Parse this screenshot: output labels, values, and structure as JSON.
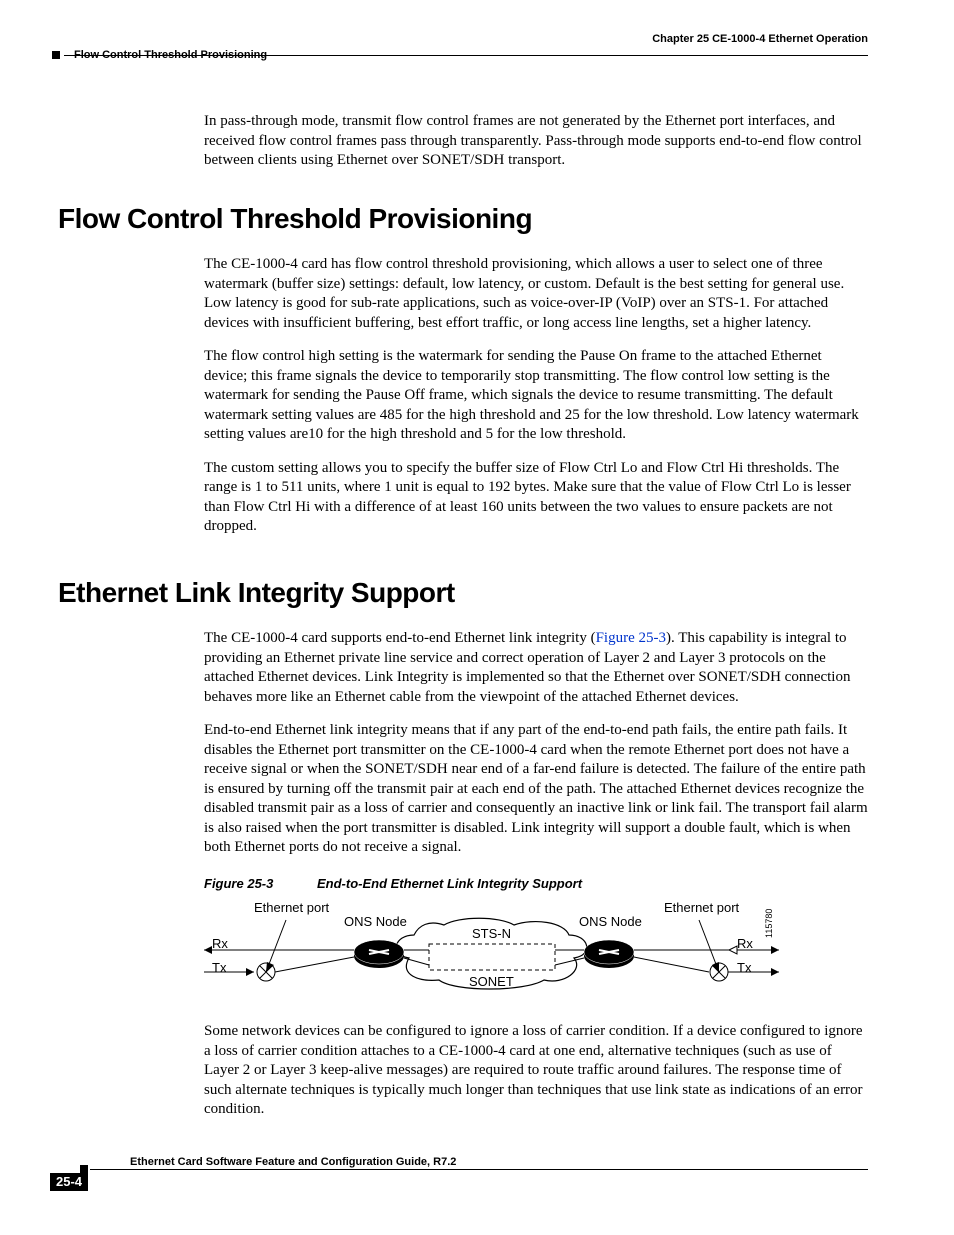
{
  "header": {
    "chapter": "Chapter 25 CE-1000-4 Ethernet Operation",
    "section": "Flow Control Threshold Provisioning"
  },
  "intro_para": "In pass-through mode, transmit flow control frames are not generated by the Ethernet port interfaces, and received flow control frames pass through transparently. Pass-through mode supports end-to-end flow control between clients using Ethernet over SONET/SDH transport.",
  "sec1": {
    "title": "Flow Control Threshold Provisioning",
    "p1": "The CE-1000-4 card has flow control threshold provisioning, which allows a user to select one of three watermark (buffer size) settings: default, low latency, or custom. Default is the best setting for general use. Low latency is good for sub-rate applications, such as voice-over-IP (VoIP) over an STS-1. For attached devices with insufficient buffering, best effort traffic, or long access line lengths, set a higher latency.",
    "p2": "The flow control high setting is the watermark for sending the Pause On frame to the attached Ethernet device; this frame signals the device to temporarily stop transmitting. The flow control low setting is the watermark for sending the Pause Off frame, which signals the device to resume transmitting. The default watermark setting values are 485 for the high threshold and 25 for the low threshold. Low latency watermark setting values are10 for the high threshold and 5 for the low threshold.",
    "p3": "The custom setting allows you to specify the buffer size of Flow Ctrl Lo and Flow Ctrl Hi thresholds. The range is 1 to 511 units, where 1 unit is equal to 192 bytes. Make sure that the value of Flow Ctrl Lo is lesser than Flow Ctrl Hi with a difference of at least 160 units between the two values to ensure packets are not dropped."
  },
  "sec2": {
    "title": "Ethernet Link Integrity Support",
    "p1a": "The CE-1000-4 card supports end-to-end Ethernet link integrity (",
    "p1link": "Figure 25-3",
    "p1b": "). This capability is integral to providing an Ethernet private line service and correct operation of Layer 2 and Layer 3 protocols on the attached Ethernet devices. Link Integrity is implemented so that the Ethernet over SONET/SDH connection behaves more like an Ethernet cable from the viewpoint of the attached Ethernet devices.",
    "p2": "End-to-end Ethernet link integrity means that if any part of the end-to-end path fails, the entire path fails. It disables the Ethernet port transmitter on the CE-1000-4 card when the remote Ethernet port does not have a receive signal or when the SONET/SDH near end of a far-end failure is detected. The failure of the entire path is ensured by turning off the transmit pair at each end of the path. The attached Ethernet devices recognize the disabled transmit pair as a loss of carrier and consequently an inactive link or link fail. The transport fail alarm is also raised when the port transmitter is disabled. Link integrity will support a double fault, which is when both Ethernet ports do not receive a signal.",
    "fig_label": "Figure 25-3",
    "fig_title": "End-to-End Ethernet Link Integrity Support",
    "p3": "Some network devices can be configured to ignore a loss of carrier condition. If a device configured to ignore a loss of carrier condition attaches to a CE-1000-4 card at one end, alternative techniques (such as use of Layer 2 or Layer 3 keep-alive messages) are required to route traffic around failures. The response time of such alternate techniques is typically much longer than techniques that use link state as indications of an error condition."
  },
  "diagram": {
    "eth_port_l": "Ethernet port",
    "eth_port_r": "Ethernet port",
    "ons_l": "ONS Node",
    "ons_r": "ONS Node",
    "sts": "STS-N",
    "sonet": "SONET",
    "rx": "Rx",
    "tx": "Tx",
    "id": "115780"
  },
  "footer": {
    "title": "Ethernet Card Software Feature and Configuration Guide, R7.2",
    "page": "25-4"
  }
}
